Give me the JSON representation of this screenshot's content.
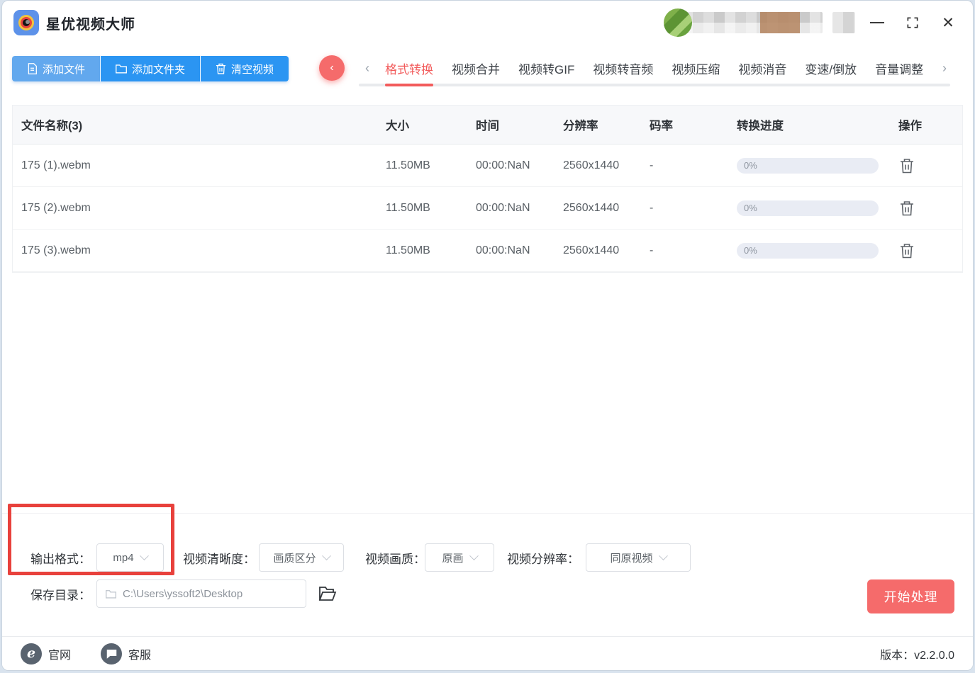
{
  "app": {
    "title": "星优视频大师"
  },
  "icons": {
    "back": "‹",
    "chevron_left": "‹",
    "chevron_right": "›",
    "close": "✕"
  },
  "toolbar": {
    "add_file": "添加文件",
    "add_folder": "添加文件夹",
    "clear_videos": "清空视频"
  },
  "tabs": {
    "items": [
      "格式转换",
      "视频合并",
      "视频转GIF",
      "视频转音频",
      "视频压缩",
      "视频消音",
      "变速/倒放",
      "音量调整"
    ],
    "active": "格式转换"
  },
  "table": {
    "headers": [
      "文件名称(3)",
      "大小",
      "时间",
      "分辨率",
      "码率",
      "转换进度",
      "操作"
    ],
    "rows": [
      {
        "name": "175 (1).webm",
        "size": "11.50MB",
        "time": "00:00:NaN",
        "resolution": "2560x1440",
        "bitrate": "-",
        "progress": "0%"
      },
      {
        "name": "175 (2).webm",
        "size": "11.50MB",
        "time": "00:00:NaN",
        "resolution": "2560x1440",
        "bitrate": "-",
        "progress": "0%"
      },
      {
        "name": "175 (3).webm",
        "size": "11.50MB",
        "time": "00:00:NaN",
        "resolution": "2560x1440",
        "bitrate": "-",
        "progress": "0%"
      }
    ]
  },
  "settings": {
    "output_format": {
      "label": "输出格式：",
      "value": "mp4"
    },
    "clarity": {
      "label": "视频清晰度：",
      "value": "画质区分"
    },
    "quality": {
      "label": "视频画质：",
      "value": "原画"
    },
    "resolution": {
      "label": "视频分辨率：",
      "value": "同原视频"
    },
    "save_dir": {
      "label": "保存目录：",
      "value": "C:\\Users\\yssoft2\\Desktop"
    },
    "start_button": "开始处理"
  },
  "footer": {
    "website": "官网",
    "support": "客服",
    "version": "版本：v2.2.0.0"
  },
  "colors": {
    "primary_blue": "#2b95f2",
    "light_blue": "#62a8ee",
    "accent_red": "#f25b5b",
    "button_red": "#f56b6b",
    "annotation_red": "#e8413c",
    "progress_bg": "#e9ecf4",
    "table_header_bg": "#f7f8fa"
  }
}
